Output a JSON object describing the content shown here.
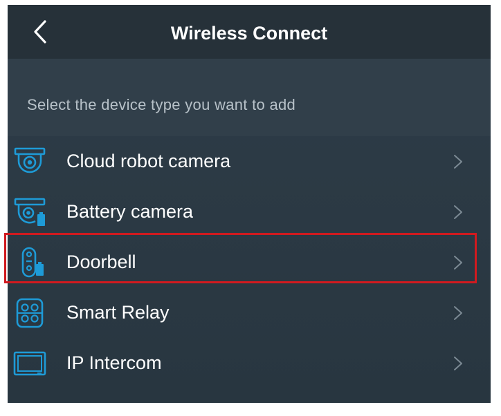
{
  "header": {
    "title": "Wireless Connect",
    "back_icon": "chevron-left-icon"
  },
  "subtitle": "Select the device type you want to add",
  "devices": [
    {
      "label": "Cloud robot camera",
      "icon": "dome-camera-icon"
    },
    {
      "label": "Battery camera",
      "icon": "battery-camera-icon"
    },
    {
      "label": "Doorbell",
      "icon": "doorbell-icon",
      "highlighted": true
    },
    {
      "label": "Smart Relay",
      "icon": "relay-icon"
    },
    {
      "label": "IP Intercom",
      "icon": "monitor-icon"
    }
  ],
  "colors": {
    "accent": "#1e9bd7",
    "highlight_border": "#d11a1f",
    "header_bg": "#263139",
    "list_bg": "#2c3a45"
  }
}
